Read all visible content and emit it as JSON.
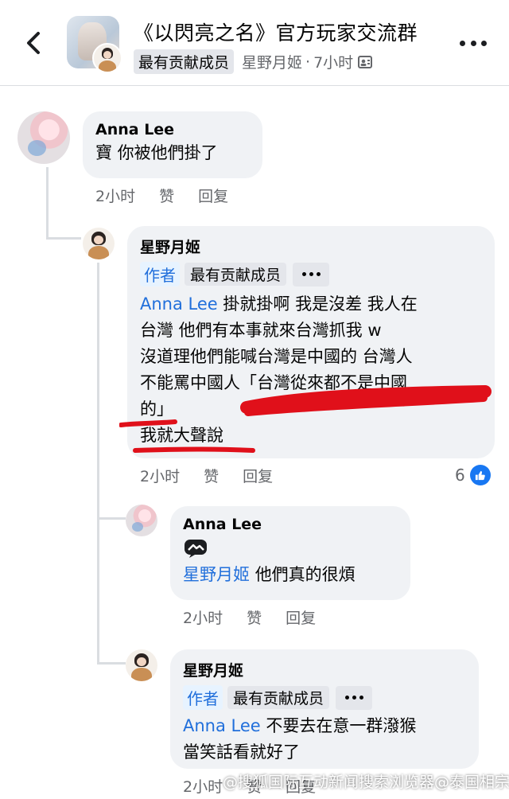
{
  "header": {
    "group_title": "《以閃亮之名》官方玩家交流群",
    "badge": "最有贡献成员",
    "poster": "星野月姬",
    "dot": "·",
    "time": "7小时",
    "privacy_icon": "members-icon"
  },
  "comments": [
    {
      "author": "Anna Lee",
      "text": "寶 你被他們掛了",
      "time": "2小时",
      "like": "赞",
      "reply": "回复"
    },
    {
      "author": "星野月姬",
      "badge_author": "作者",
      "badge_contrib": "最有贡献成员",
      "mention": "Anna Lee",
      "line1_rest": "掛就掛啊 我是沒差 我人在",
      "line2": "台灣 他們有本事就來台灣抓我 w",
      "line3": "沒道理他們能喊台灣是中國的 台灣人",
      "line4": "不能罵中國人「台灣從來都不是中國",
      "line5": "的」",
      "line6": "我就大聲說",
      "time": "2小时",
      "like": "赞",
      "reply": "回复",
      "like_count": "6"
    },
    {
      "author": "Anna Lee",
      "mention": "星野月姬",
      "text_rest": "他們真的很煩",
      "time": "2小时",
      "like": "赞",
      "reply": "回复"
    },
    {
      "author": "星野月姬",
      "badge_author": "作者",
      "badge_contrib": "最有贡献成员",
      "mention": "Anna Lee",
      "line1_rest": "不要去在意一群潑猴",
      "line2": "當笑話看就好了",
      "time": "2小时",
      "like": "赞",
      "reply": "回复"
    }
  ],
  "watermark": "@搜狐国际互动新闻搜索浏览器@泰国相宗游",
  "colors": {
    "mention": "#216fdb",
    "bubble": "#f0f2f5",
    "meta": "#65676b",
    "like": "#1877f2",
    "annotation": "#e0101a"
  }
}
